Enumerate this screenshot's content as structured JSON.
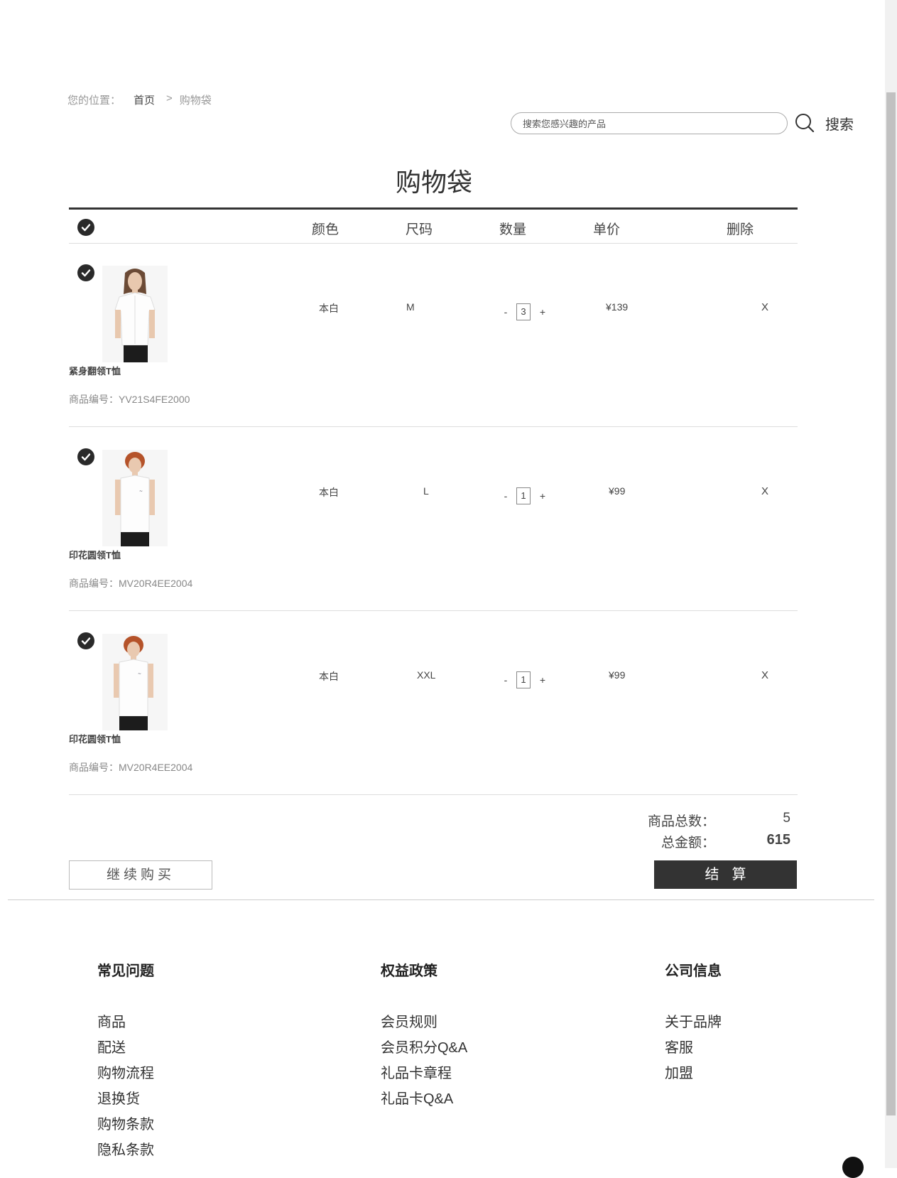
{
  "breadcrumb": {
    "prefix": "您的位置：",
    "home": "首页",
    "separator": ">",
    "current": "购物袋"
  },
  "search": {
    "placeholder": "搜索您感兴趣的产品",
    "button_label": "搜索",
    "icon": "search-icon"
  },
  "title": "购物袋",
  "table_headers": {
    "color": "颜色",
    "size": "尺码",
    "quantity": "数量",
    "unit_price": "单价",
    "delete": "删除"
  },
  "items": [
    {
      "name": "紧身翻领T恤",
      "code": "商品编号：YV21S4FE2000",
      "color": "本白",
      "size": "M",
      "quantity": "3",
      "price": "¥139",
      "delete_label": "X",
      "checked": true
    },
    {
      "name": "印花圆领T恤",
      "code": "商品编号：MV20R4EE2004",
      "color": "本白",
      "size": "L",
      "quantity": "1",
      "price": "¥99",
      "delete_label": "X",
      "checked": true
    },
    {
      "name": "印花圆领T恤",
      "code": "商品编号：MV20R4EE2004",
      "color": "本白",
      "size": "XXL",
      "quantity": "1",
      "price": "¥99",
      "delete_label": "X",
      "checked": true
    }
  ],
  "qty_controls": {
    "minus": "-",
    "plus": "+"
  },
  "summary": {
    "count_label": "商品总数：",
    "count_value": "5",
    "amount_label": "总金额：",
    "amount_value": "615"
  },
  "buttons": {
    "continue": "继续购买",
    "checkout": "结算"
  },
  "footer": {
    "columns": [
      {
        "title": "常见问题",
        "links": [
          "商品",
          "配送",
          "购物流程",
          "退换货",
          "购物条款",
          "隐私条款"
        ]
      },
      {
        "title": "权益政策",
        "links": [
          "会员规则",
          "会员积分Q&A",
          "礼品卡章程",
          "礼品卡Q&A"
        ]
      },
      {
        "title": "公司信息",
        "links": [
          "关于品牌",
          "客服",
          "加盟"
        ]
      }
    ]
  },
  "colors": {
    "accent_dark": "#333333",
    "divider": "#dddddd",
    "muted_text": "#999999"
  }
}
